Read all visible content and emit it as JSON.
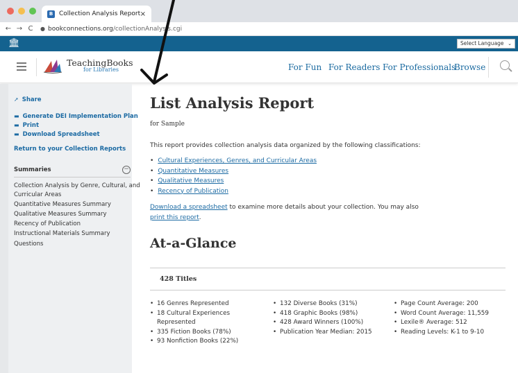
{
  "browser": {
    "tab_title": "Collection Analysis Report",
    "tab_close": "×",
    "url_host": "bookconnections.org",
    "url_path": "/collectionAnalysis.cgi",
    "back": "←",
    "forward": "→",
    "reload": "C",
    "lock": "🔒",
    "dot_colors": [
      "#ed6a5e",
      "#f5bf4f",
      "#61c554"
    ]
  },
  "utility": {
    "language_label": "Select Language",
    "caret": "⌄"
  },
  "header": {
    "logo_main": "TeachingBooks",
    "logo_sub": "for Libraries",
    "nav": [
      "For Fun",
      "For Readers",
      "For Professionals",
      "Browse"
    ]
  },
  "sidebar": {
    "share": "Share",
    "generate": "Generate DEI Implementation Plan",
    "print": "Print",
    "download": "Download Spreadsheet",
    "return": "Return to your Collection Reports",
    "summaries_heading": "Summaries",
    "collapse": "−",
    "summary_line1": "Collection Analysis by Genre, Cultural, and",
    "summary_line2": "Curricular Areas",
    "quantitative": "Quantitative Measures Summary",
    "qualitative": "Qualitative Measures Summary",
    "recency": "Recency of Publication",
    "instructional": "Instructional Materials Summary",
    "questions": "Questions"
  },
  "main": {
    "title": "List Analysis Report",
    "subtitle": "for Sample",
    "intro": "This report provides collection analysis data organized by the following classifications:",
    "classifications": [
      "Cultural Experiences, Genres, and Curricular Areas",
      "Quantitative Measures",
      "Qualitative Measures",
      "Recency of Publication"
    ],
    "download_link": "Download a spreadsheet",
    "download_text": " to examine more details about your collection. You may also",
    "print_link": "print this report",
    "print_end": ".",
    "at_a_glance": "At-a-Glance",
    "titles_count": "428 Titles",
    "col1": [
      "16 Genres Represented",
      "18 Cultural Experiences",
      "Represented",
      "335 Fiction Books (78%)",
      "93 Nonfiction Books (22%)"
    ],
    "col2": [
      "132 Diverse Books (31%)",
      "418 Graphic Books (98%)",
      "428 Award Winners (100%)",
      "Publication Year Median: 2015"
    ],
    "col3": [
      "Page Count Average: 200",
      "Word Count Average: 11,559",
      "Lexile® Average: 512",
      "Reading Levels: K-1 to 9-10"
    ]
  },
  "colors": {
    "brand_blue": "#14628f",
    "link_blue": "#1b6aa3",
    "sidebar_bg": "#eef0f2"
  }
}
